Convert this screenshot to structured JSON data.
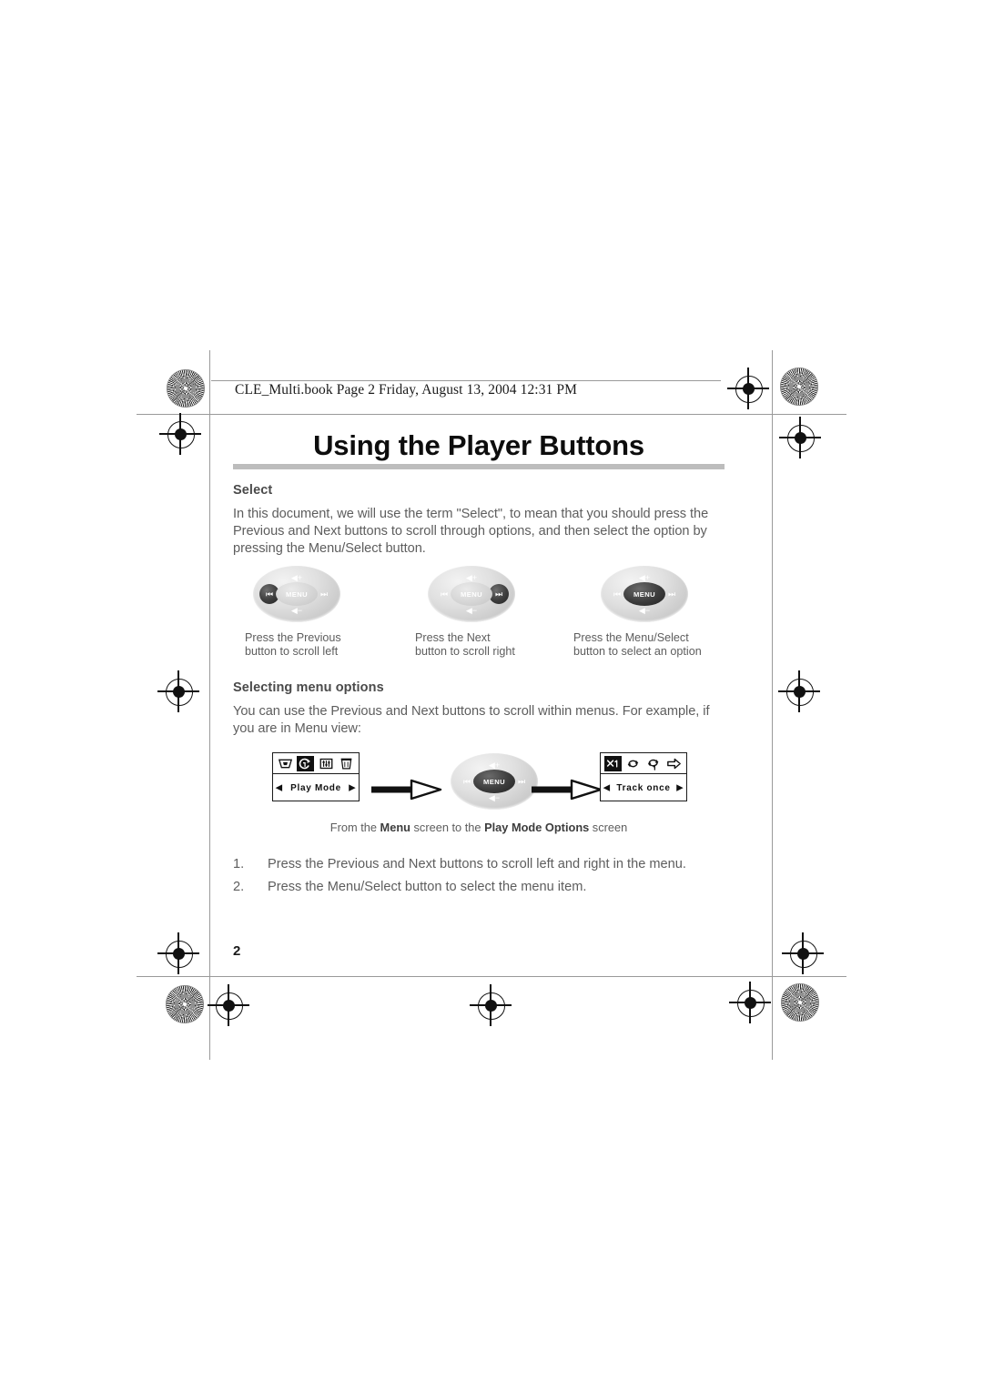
{
  "document": {
    "file_header": "CLE_Multi.book  Page 2  Friday, August 13, 2004  12:31 PM",
    "title": "Using the Player Buttons",
    "folio": "2"
  },
  "sections": [
    {
      "heading": "Select",
      "paragraph": "In this document, we will use the term \"Select\", to mean that you should press the Previous and Next buttons to scroll through options, and then select the option by pressing the Menu/Select button."
    },
    {
      "heading": "Selecting menu options",
      "paragraph": "You can use the Previous and Next buttons to scroll within menus. For example, if you are in Menu view:"
    }
  ],
  "button_figures": [
    {
      "selected": "previous",
      "caption_line1": "Press the Previous",
      "caption_line2": "button to scroll left"
    },
    {
      "selected": "next",
      "caption_line1": "Press the Next",
      "caption_line2": "button to scroll right"
    },
    {
      "selected": "menu",
      "caption_line1": "Press the Menu/Select",
      "caption_line2": "button to select an option"
    }
  ],
  "control_pad": {
    "menu_label": "MENU",
    "prev_glyph": "⏮",
    "next_glyph": "⏭",
    "vol_up_glyph": "◀+",
    "vol_down_glyph": "◀−"
  },
  "flow_diagram": {
    "caption_prefix": "From the ",
    "caption_bold1": "Menu",
    "caption_middle": " screen to the ",
    "caption_bold2": "Play Mode Options",
    "caption_suffix": " screen",
    "screens": [
      {
        "name": "menu-screen",
        "label": "Play Mode",
        "left_arrow": "◀",
        "right_arrow": "▶",
        "icons": [
          {
            "name": "display-settings-icon",
            "glyph": "▱",
            "selected": false
          },
          {
            "name": "play-mode-icon",
            "glyph": "↺",
            "selected": true
          },
          {
            "name": "equalizer-icon",
            "glyph": "▥",
            "selected": false
          },
          {
            "name": "trash-delete-icon",
            "glyph": "🗑",
            "selected": false
          }
        ]
      },
      {
        "name": "play-mode-options-screen",
        "label": "Track once",
        "left_arrow": "◀",
        "right_arrow": "▶",
        "icons": [
          {
            "name": "play-track-once-icon",
            "glyph": "✕1",
            "selected": true
          },
          {
            "name": "repeat-all-icon",
            "glyph": "↻",
            "selected": false
          },
          {
            "name": "repeat-one-icon",
            "glyph": "↻1",
            "selected": false
          },
          {
            "name": "play-through-icon",
            "glyph": "⇨",
            "selected": false
          }
        ]
      }
    ]
  },
  "numbered_steps": [
    {
      "number": "1.",
      "text": "Press the Previous and Next buttons to scroll left and right in the menu."
    },
    {
      "number": "2.",
      "text": "Press the Menu/Select button to select the menu item."
    }
  ],
  "colors": {
    "title_rule": "#bdbdbd",
    "body_text": "#5d5d5d",
    "heading_text": "#4a4a4a",
    "lcd_border": "#1a1a1a"
  }
}
